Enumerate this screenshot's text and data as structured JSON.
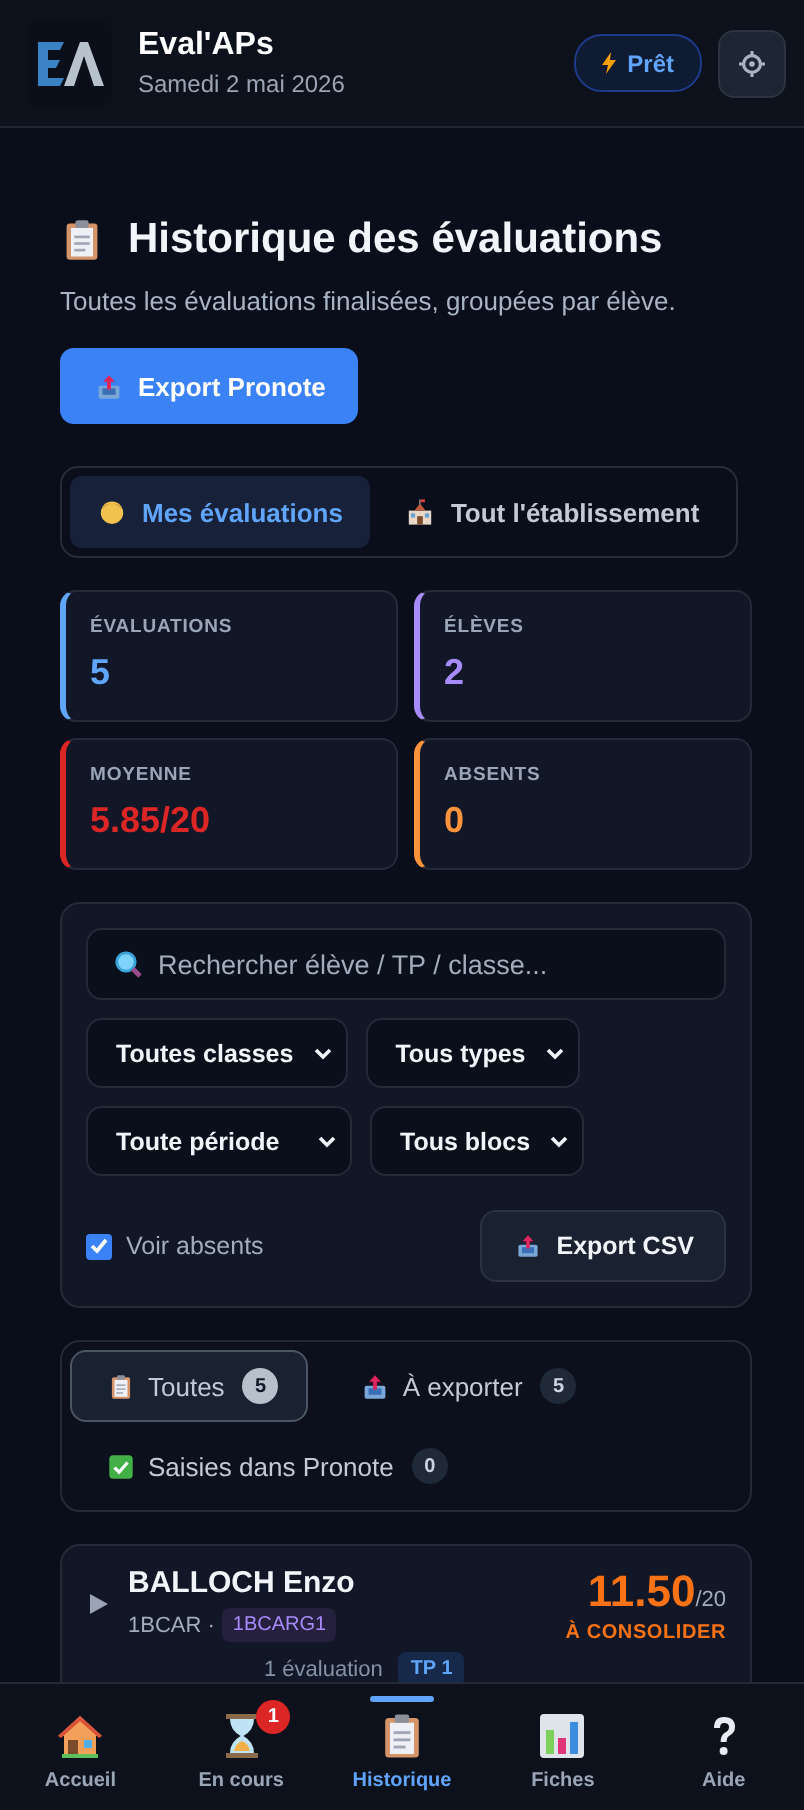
{
  "app": {
    "name": "Eval'APs",
    "date": "Samedi 2 mai 2026",
    "status": "Prêt"
  },
  "page": {
    "title": "Historique des évaluations",
    "subtitle": "Toutes les évaluations finalisées, groupées par élève.",
    "export_button": "Export Pronote"
  },
  "scope_tabs": [
    {
      "label": "Mes évaluations",
      "kind": "person",
      "selected": true
    },
    {
      "label": "Tout l'établissement",
      "kind": "school",
      "selected": false
    }
  ],
  "stats": [
    {
      "label": "ÉVALUATIONS",
      "value": "5",
      "color": "#60a5fa"
    },
    {
      "label": "ÉLÈVES",
      "value": "2",
      "color": "#a78bfa"
    },
    {
      "label": "MOYENNE",
      "value": "5.85/20",
      "color": "#dc2626"
    },
    {
      "label": "ABSENTS",
      "value": "0",
      "color": "#fb923c"
    }
  ],
  "filters": {
    "search": {
      "placeholder": "Rechercher élève / TP / classe..."
    },
    "selects": [
      "Toutes classes",
      "Tous types",
      "Toute période",
      "Tous blocs"
    ],
    "show_absent": {
      "label": "Voir absents",
      "checked": true
    },
    "export_csv": "Export CSV"
  },
  "status_tabs": [
    {
      "label": "Toutes",
      "count": "5",
      "kind": "clipboard",
      "selected": true
    },
    {
      "label": "À exporter",
      "count": "5",
      "kind": "export",
      "selected": false
    },
    {
      "label": "Saisies dans Pronote",
      "count": "0",
      "kind": "check",
      "selected": false
    }
  ],
  "students": [
    {
      "name": "BALLOCH Enzo",
      "class": "1BCAR",
      "separator": "·",
      "group": "1BCARG1",
      "score": "11.50",
      "max": "/20",
      "level_label": "À CONSOLIDER",
      "color": "#f97316",
      "count": "1 évaluation",
      "tag": "TP 1",
      "expanded": false
    }
  ],
  "nav": [
    {
      "label": "Accueil",
      "kind": "home",
      "selected": false
    },
    {
      "label": "En cours",
      "kind": "hourglass",
      "badge": "1",
      "selected": false
    },
    {
      "label": "Historique",
      "kind": "clipboard",
      "selected": true
    },
    {
      "label": "Fiches",
      "kind": "chart",
      "selected": false
    },
    {
      "label": "Aide",
      "kind": "help",
      "selected": false
    }
  ]
}
